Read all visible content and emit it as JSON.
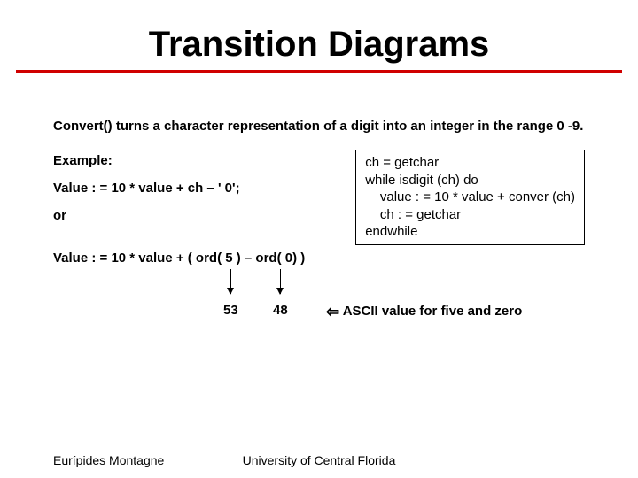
{
  "title": "Transition Diagrams",
  "description": "Convert() turns a character representation of a digit into an integer in the range 0 -9.",
  "example_label": "Example:",
  "expr1": "Value : = 10 * value + ch – ' 0';",
  "or_label": "or",
  "codebox": "ch = getchar\nwhile isdigit (ch) do\n    value : = 10 * value + conver (ch)\n    ch : = getchar\nendwhile",
  "expr2": "Value : = 10 * value + ( ord( 5 ) – ord( 0) )",
  "num1": "53",
  "num2": "48",
  "arrow_glyph": "⇦",
  "ascii_note": " ASCII value for five and zero",
  "footer_left": "Eurípides Montagne",
  "footer_center": "University of Central Florida"
}
